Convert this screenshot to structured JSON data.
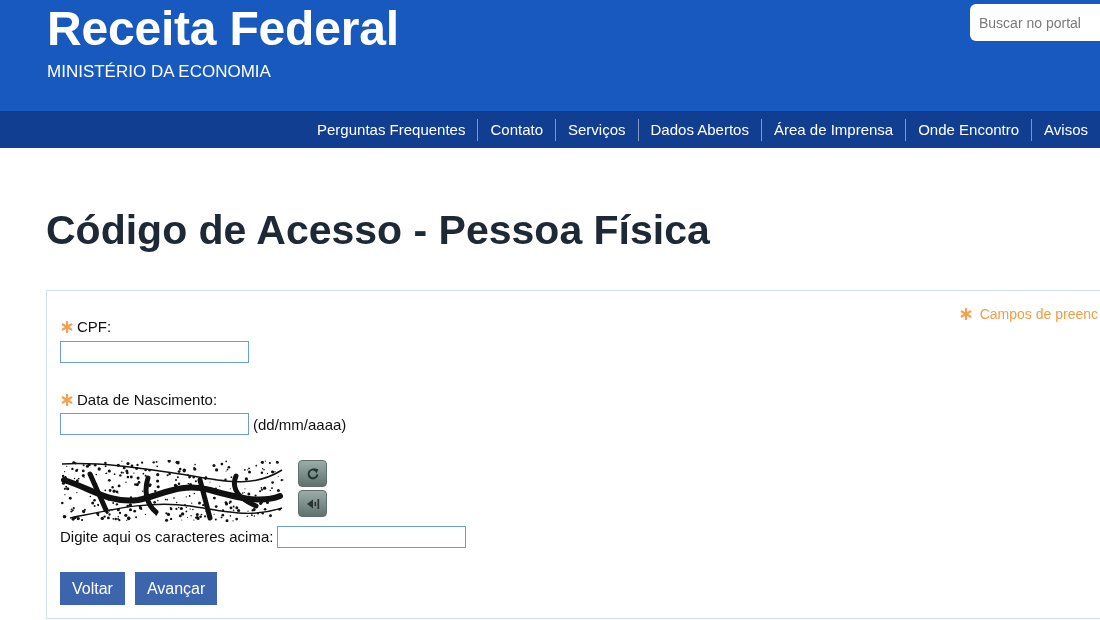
{
  "header": {
    "title": "Receita Federal",
    "subtitle": "MINISTÉRIO DA ECONOMIA",
    "search": {
      "placeholder": "Buscar no portal"
    }
  },
  "nav": {
    "items": [
      "Perguntas Frequentes",
      "Contato",
      "Serviços",
      "Dados Abertos",
      "Área de Imprensa",
      "Onde Encontro",
      "Avisos"
    ]
  },
  "page_title": "Código de Acesso - Pessoa Física",
  "form": {
    "required_note": "Campos de preenc",
    "fields": [
      {
        "label": "CPF:",
        "required": true
      },
      {
        "label": "Data de Nascimento:",
        "required": true,
        "hint": "(dd/mm/aaaa)"
      }
    ],
    "captcha": {
      "label": "Digite aqui os caracteres acima:"
    },
    "buttons": [
      "Voltar",
      "Avançar"
    ]
  }
}
